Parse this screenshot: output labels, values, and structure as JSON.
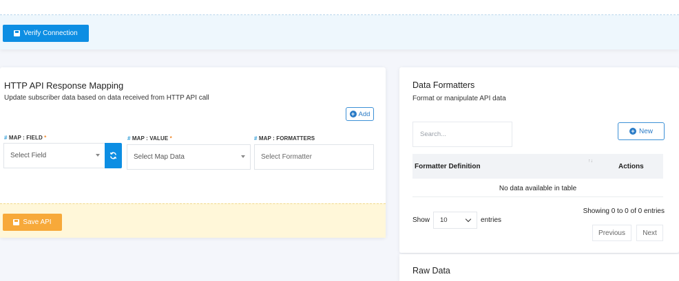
{
  "top": {
    "verify_label": "Verify Connection"
  },
  "mapping": {
    "title": "HTTP API Response Mapping",
    "subtitle": "Update subscriber data based on data received from HTTP API call",
    "add_label": "Add",
    "field_label": "MAP : FIELD",
    "value_label": "MAP : VALUE",
    "formatters_label": "MAP : FORMATTERS",
    "required_mark": "*",
    "hash": "#",
    "field_placeholder": "Select Field",
    "value_placeholder": "Select Map Data",
    "formatter_placeholder": "Select Formatter",
    "save_label": "Save API"
  },
  "formatters": {
    "title": "Data Formatters",
    "subtitle": "Format or manipulate API data",
    "search_placeholder": "Search...",
    "new_label": "New",
    "col_definition": "Formatter Definition",
    "col_actions": "Actions",
    "empty_text": "No data available in table",
    "show_label": "Show",
    "page_size": "10",
    "entries_label": "entries",
    "info_text": "Showing 0 to 0 of 0 entries",
    "previous_label": "Previous",
    "next_label": "Next"
  },
  "raw": {
    "title": "Raw Data"
  },
  "colors": {
    "primary": "#0d8ee3",
    "warning": "#f7a93a",
    "accent_required": "#f08a2c"
  }
}
